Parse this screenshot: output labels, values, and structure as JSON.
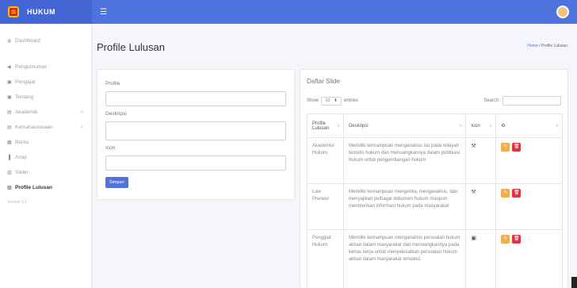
{
  "brand": {
    "name": "HUKUM",
    "logo_glyph": "⚖",
    "color": "#4e73df"
  },
  "topbar": {
    "menu_icon": "☰"
  },
  "sidebar": {
    "items": [
      {
        "label": "Dashboard",
        "icon": "◍",
        "arrow": ""
      },
      {
        "label": "Pengumuman",
        "icon": "◀",
        "arrow": ""
      },
      {
        "label": "Pengajar",
        "icon": "▣",
        "arrow": ""
      },
      {
        "label": "Tentang",
        "icon": "▣",
        "arrow": ""
      },
      {
        "label": "Akademik",
        "icon": "▤",
        "arrow": ">"
      },
      {
        "label": "Kemahasiswaan",
        "icon": "▤",
        "arrow": ">"
      },
      {
        "label": "Berita",
        "icon": "▦",
        "arrow": ""
      },
      {
        "label": "Arsip",
        "icon": "▐",
        "arrow": ""
      },
      {
        "label": "Slider",
        "icon": "▥",
        "arrow": ""
      },
      {
        "label": "Profile Lulusan",
        "icon": "▥",
        "arrow": ""
      }
    ],
    "version": "Version 1.1"
  },
  "page": {
    "title": "Profile Lulusan",
    "breadcrumb_home": "Home",
    "breadcrumb_sep": "/",
    "breadcrumb_current": "Profile Lulusan"
  },
  "form": {
    "profile_label": "Profile",
    "deskripsi_label": "Deskripsi",
    "icon_label": "Icon",
    "save_label": "Simpan"
  },
  "table": {
    "title": "Daftar Slide",
    "show_label": "Show",
    "entries_value": "10",
    "entries_label": "entries",
    "search_label": "Search:",
    "headers": [
      "Profile Lulusan",
      "Deskripsi",
      "Icon",
      "⚙"
    ],
    "rows": [
      {
        "profile": "Akademisi Hukum",
        "deskripsi": "Memiliki kemampuan menganalisis isu pada wilayah teoretis hukum dan menuangkannya dalam publikasi hukum untuk pengembangan hukum",
        "icon": "⚒"
      },
      {
        "profile": "Law Preneur",
        "deskripsi": "Memiliki kemampuan mengelola, menganalisis, dan menyajikan pelbagai dokumen hukum maupun memberikan informasi hukum pada masyarakat",
        "icon": "⚒"
      },
      {
        "profile": "Penggiat Hukum",
        "deskripsi": "Memiliki kemampuan menganalisis persoalan hukum aktual dalam masyarakat dan menuangkannya pada kertas kerja untuk menyelesaikan persoalan hukum aktual dalam masyarakat tersebut.",
        "icon": "▣"
      }
    ]
  }
}
